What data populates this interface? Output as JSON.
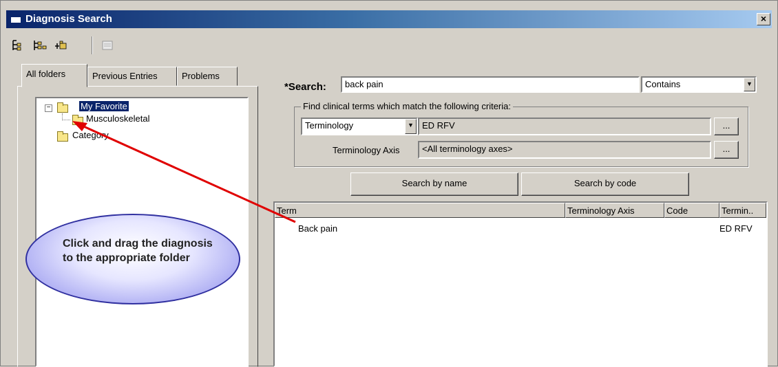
{
  "window": {
    "title": "Diagnosis Search",
    "close_glyph": "×"
  },
  "toolbar": {
    "icons": [
      "tree-expand-icon",
      "tree-collapse-icon",
      "add-folder-icon",
      "properties-icon"
    ]
  },
  "tabs": [
    {
      "label": "All folders",
      "active": true
    },
    {
      "label": "Previous Entries",
      "active": false
    },
    {
      "label": "Problems",
      "active": false
    }
  ],
  "tree": {
    "expander": "−",
    "items": [
      {
        "label": "My Favorite",
        "selected": true
      },
      {
        "label": "Musculoskeletal",
        "selected": false
      },
      {
        "label": "Category",
        "selected": false
      }
    ]
  },
  "search": {
    "label": "*Search:",
    "value": "back pain",
    "mode": "Contains",
    "criteria_label": "Find clinical terms which match the following criteria:",
    "criteria_type": "Terminology",
    "terminology_value": "ED RFV",
    "axis_label": "Terminology Axis",
    "axis_value": "<All terminology axes>",
    "browse_label": "...",
    "by_name_label": "Search by name",
    "by_code_label": "Search by code"
  },
  "results": {
    "columns": [
      "Term",
      "Terminology Axis",
      "Code",
      "Termin.."
    ],
    "rows": [
      {
        "term": "Back pain",
        "axis": "",
        "code": "",
        "terminology": "ED RFV"
      }
    ]
  },
  "callout": {
    "text": "Click and drag the diagnosis to the appropriate folder"
  },
  "colors": {
    "arrow": "#e00000",
    "selection": "#0a246a",
    "window_face": "#d4d0c8"
  }
}
